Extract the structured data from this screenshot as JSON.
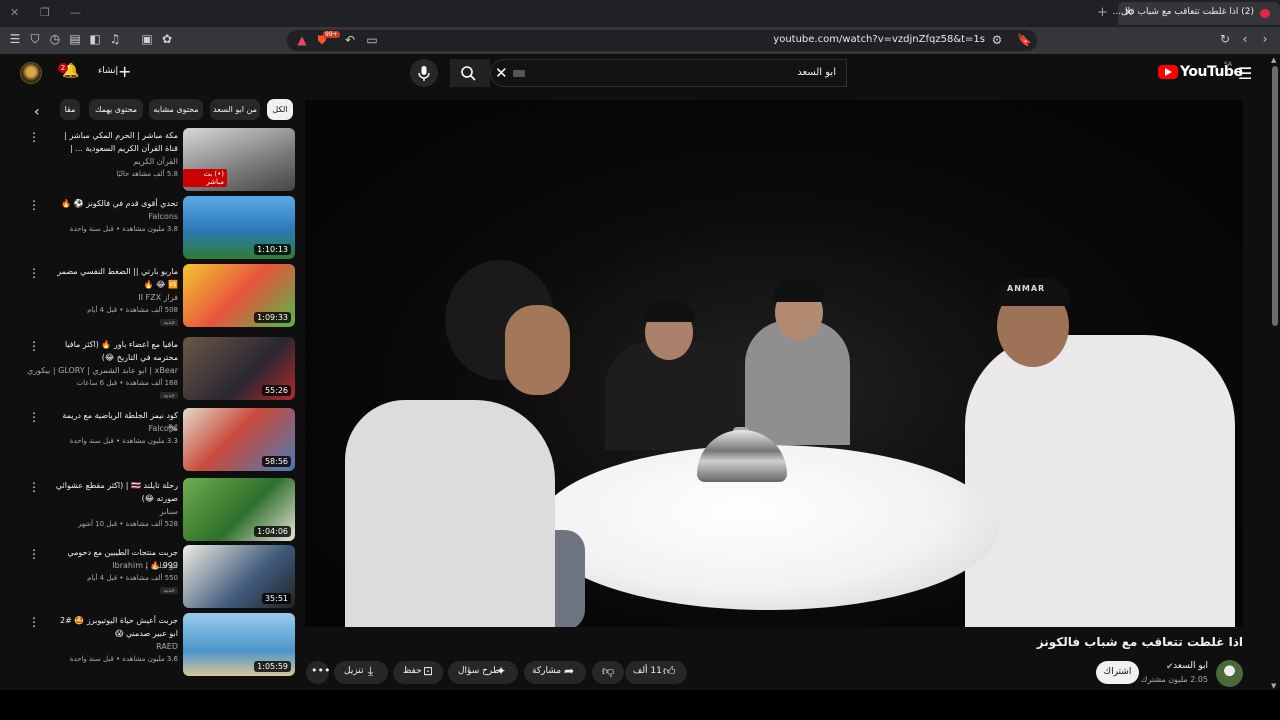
{
  "browser": {
    "tab_title": "(2) اذا غلطت تتعاقب مع شباب فال...",
    "url": "youtube.com/watch?v=vzdjnZfqz58&t=1s",
    "shield_badge": "99+"
  },
  "masthead": {
    "logo_text": "YouTube",
    "region": "SA",
    "search_value": "ابو السعد",
    "create_label": "إنشاء",
    "notif_count": "2"
  },
  "chips": [
    {
      "label": "الكل",
      "active": true
    },
    {
      "label": "من ابو السعد"
    },
    {
      "label": "محتوى مشابه"
    },
    {
      "label": "محتوى يهمك"
    },
    {
      "label": "مقا"
    }
  ],
  "recommendations": [
    {
      "title": "مكة مباشر | الحرم المكي مباشر | قناة القرآن الكريم السعودية ... | Makkah Live",
      "channel": "القرآن الكريم",
      "meta": "5.8 ألف مشاهد حاليًا",
      "live": "(•) بث مباشر",
      "thumb_colors": [
        "#cfcfcf",
        "#6d6d6d"
      ]
    },
    {
      "title": "تحدي أقوى قدم في فالكونز ⚽ 🔥",
      "channel": "Falcons",
      "meta": "3.8 مليون مشاهدة • قبل سنة واحدة",
      "duration": "1:10:13",
      "thumb_colors": [
        "#3b8fd1",
        "#1f6a2f"
      ]
    },
    {
      "title": "ماريو بارتي || الضغط النفسي مضمر 🆚 😂 🔥",
      "channel": "فراز II FZX",
      "meta": "508 آلف مشاهدة • قبل 4 أيام",
      "duration": "1:09:33",
      "new": "جديد",
      "thumb_colors": [
        "#f1c232",
        "#e24a4a"
      ]
    },
    {
      "title": "مافيا مع اعضاء باور 🔥 (اكثر مافيا محترمه في التاريخ 😂)",
      "channel": "xBear | ابو عابد الشمري | GLORY | بيكوري",
      "meta": "168 ألف مشاهدة • قبل 6 ساعات",
      "duration": "55:26",
      "new": "جديد",
      "thumb_colors": [
        "#5a4a3a",
        "#1e1e28"
      ]
    },
    {
      "title": "كود نيمز الجلطة الرياضية مع دريمة 🛩",
      "channel": "Falcons",
      "meta": "3.3 مليون مشاهدة • قبل سنة واحدة",
      "duration": "58:56",
      "thumb_colors": [
        "#d9d2c4",
        "#4a7ab8"
      ]
    },
    {
      "title": "رحلة تايلند 🇹🇭 | (اكثر مقطع عشوائي صورته 😂)",
      "channel": "سنابر",
      "meta": "528 ألف مشاهدة • قبل 10 أشهر",
      "duration": "1:04:06",
      "thumb_colors": [
        "#4f8f3a",
        "#2c6a2a"
      ]
    },
    {
      "title": "جربت منتجات الطيبين مع دحومي 999 🔥 .",
      "channel": "ابو خليل | Ibrahim",
      "meta": "550 ألف مشاهدة • قبل 4 أيام",
      "duration": "35:51",
      "new": "جديد",
      "thumb_colors": [
        "#e9e4d8",
        "#3e5a7a"
      ]
    },
    {
      "title": "جربت أعيش حياة اليوتيوبرز 🤩 #2 ابو عبير صدمني 😱",
      "channel": "RAED",
      "meta": "3.6 مليون مشاهدة • قبل سنة واحدة",
      "duration": "1:05:59",
      "thumb_colors": [
        "#7fb8e0",
        "#3a8fc8"
      ]
    }
  ],
  "video": {
    "title": "اذا غلطت تتعاقب مع شباب فالكونز",
    "cap_text": "ANMAR",
    "channel": "ابو السعد",
    "subs": "2.05 مليون مشترك",
    "subscribe": "اشتراك",
    "likes": "11 ألف",
    "share": "مشاركة",
    "ask": "طرح سؤال",
    "save": "حفظ",
    "download": "تنزيل"
  }
}
